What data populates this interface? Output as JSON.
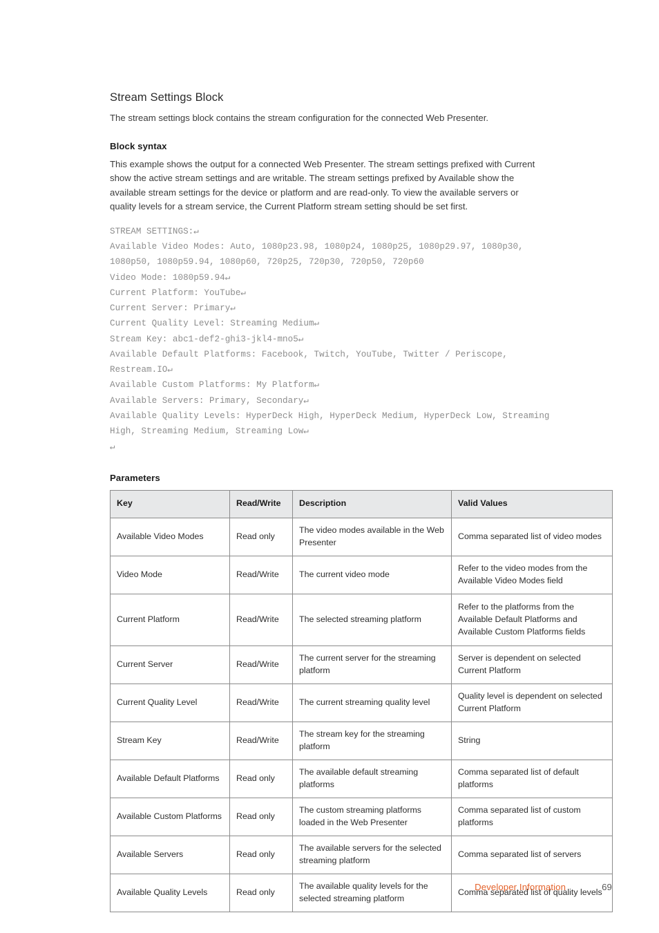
{
  "page": {
    "section_title": "Stream Settings Block",
    "intro_paragraph": "The stream settings block contains the stream configuration for the connected Web Presenter."
  },
  "block_syntax": {
    "heading": "Block syntax",
    "paragraph": "This example shows the output for a connected Web Presenter. The stream settings prefixed with Current show the active stream settings and are writable. The stream settings prefixed by Available show the available stream settings for the device or platform and are read-only. To view the available servers or quality levels for a stream service, the Current Platform stream setting should be set first.",
    "code_lines": [
      "STREAM SETTINGS:↵",
      "Available Video Modes: Auto, 1080p23.98, 1080p24, 1080p25, 1080p29.97, 1080p30, 1080p50, 1080p59.94, 1080p60, 720p25, 720p30, 720p50, 720p60",
      "Video Mode: 1080p59.94↵",
      "Current Platform: YouTube↵",
      "Current Server: Primary↵",
      "Current Quality Level: Streaming Medium↵",
      "Stream Key: abc1-def2-ghi3-jkl4-mno5↵",
      "Available Default Platforms: Facebook, Twitch, YouTube, Twitter / Periscope, Restream.IO↵",
      "Available Custom Platforms: My Platform↵",
      "Available Servers: Primary, Secondary↵",
      "Available Quality Levels: HyperDeck High, HyperDeck Medium, HyperDeck Low, Streaming High, Streaming Medium, Streaming Low↵",
      "↵"
    ]
  },
  "parameters": {
    "heading": "Parameters",
    "columns": [
      "Key",
      "Read/Write",
      "Description",
      "Valid Values"
    ],
    "rows": [
      {
        "key": "Available Video Modes",
        "read_write": "Read only",
        "description": "The video modes available in the Web Presenter",
        "valid_values": "Comma separated list of video modes"
      },
      {
        "key": "Video Mode",
        "read_write": "Read/Write",
        "description": "The current video mode",
        "valid_values": "Refer to the video modes from the Available Video Modes field"
      },
      {
        "key": "Current Platform",
        "read_write": "Read/Write",
        "description": "The selected streaming platform",
        "valid_values": "Refer to the platforms from the Available Default Platforms and Available Custom Platforms fields"
      },
      {
        "key": "Current Server",
        "read_write": "Read/Write",
        "description": "The current server for the streaming platform",
        "valid_values": "Server is dependent on selected Current Platform"
      },
      {
        "key": "Current Quality Level",
        "read_write": "Read/Write",
        "description": "The current streaming quality level",
        "valid_values": "Quality level is dependent on selected Current Platform"
      },
      {
        "key": "Stream Key",
        "read_write": "Read/Write",
        "description": "The stream key for the streaming platform",
        "valid_values": "String"
      },
      {
        "key": "Available Default Platforms",
        "read_write": "Read only",
        "description": "The available default streaming platforms",
        "valid_values": "Comma separated list of default platforms"
      },
      {
        "key": "Available Custom Platforms",
        "read_write": "Read only",
        "description": "The custom streaming platforms loaded in the Web Presenter",
        "valid_values": "Comma separated list of custom platforms"
      },
      {
        "key": "Available Servers",
        "read_write": "Read only",
        "description": "The available servers for the selected streaming platform",
        "valid_values": "Comma separated list of servers"
      },
      {
        "key": "Available Quality Levels",
        "read_write": "Read only",
        "description": "The available quality levels for the selected streaming platform",
        "valid_values": "Comma separated list of quality levels"
      }
    ]
  },
  "footer": {
    "label": "Developer Information",
    "page_number": "69"
  },
  "colors": {
    "accent": "#e4622b",
    "table_border": "#8b8b8b",
    "table_header_bg": "#e7e8e9",
    "code_text": "#8d8d8d",
    "body_text": "#3b3b3b"
  }
}
